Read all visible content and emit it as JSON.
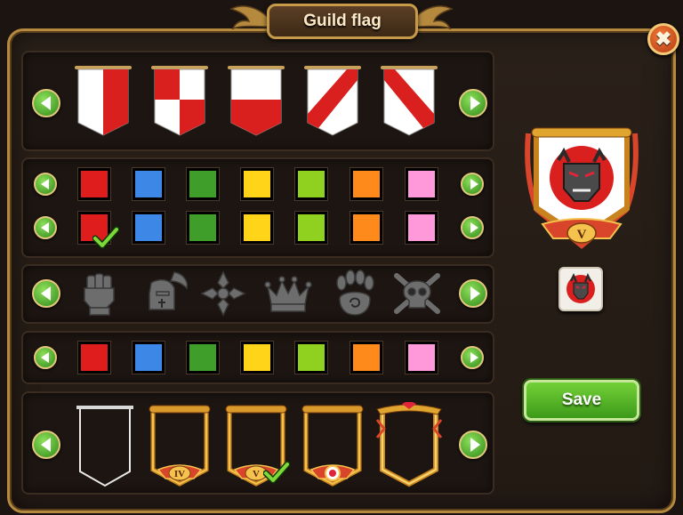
{
  "header": {
    "title": "Guild flag",
    "close_label": "✖"
  },
  "flag_shapes": [
    {
      "id": "red-stripe-right",
      "colors": [
        "#ffffff",
        "#d9201e"
      ]
    },
    {
      "id": "quarters",
      "colors": [
        "#ffffff",
        "#d9201e"
      ]
    },
    {
      "id": "lower-half",
      "colors": [
        "#ffffff",
        "#d9201e"
      ]
    },
    {
      "id": "diagonal-left",
      "colors": [
        "#ffffff",
        "#d9201e"
      ]
    },
    {
      "id": "diagonal-right",
      "colors": [
        "#ffffff",
        "#d9201e"
      ]
    }
  ],
  "palette": [
    "#e01d1d",
    "#3d87e6",
    "#3f9e2a",
    "#ffd419",
    "#8fd11e",
    "#ff8a1c",
    "#ff99d9"
  ],
  "selected": {
    "primary_color_index": 0,
    "secondary_color_index": 0,
    "frame_index": 2
  },
  "emblems": [
    "fist-icon",
    "winged-helmet-icon",
    "cross-icon",
    "crown-icon",
    "paw-icon",
    "skull-icon"
  ],
  "frames": [
    {
      "id": "frame-plain",
      "label": ""
    },
    {
      "id": "frame-iv",
      "label": "IV"
    },
    {
      "id": "frame-v",
      "label": "V"
    },
    {
      "id": "frame-gem",
      "label": ""
    },
    {
      "id": "frame-ornate",
      "label": ""
    }
  ],
  "preview": {
    "badge": "V",
    "emblem": "demon-mask-icon"
  },
  "save_label": "Save"
}
